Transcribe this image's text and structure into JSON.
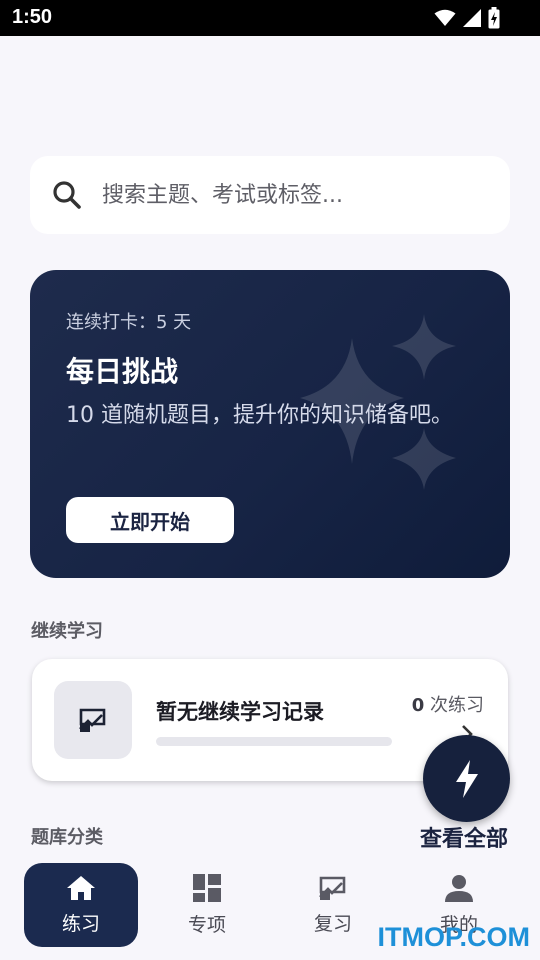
{
  "status_bar": {
    "time": "1:50"
  },
  "search": {
    "placeholder": "搜索主题、考试或标签..."
  },
  "daily_challenge": {
    "streak_text": "连续打卡：5 天",
    "title": "每日挑战",
    "description": "10 道随机题目，提升你的知识储备吧。",
    "button_label": "立即开始"
  },
  "continue_learning": {
    "section_label": "继续学习",
    "title": "暂无继续学习记录",
    "count_number": "0",
    "count_unit": "次练习",
    "progress": 0
  },
  "question_bank": {
    "section_label": "题库分类",
    "view_all": "查看全部"
  },
  "bottom_nav": {
    "items": [
      {
        "label": "练习",
        "icon": "home-icon",
        "active": true
      },
      {
        "label": "专项",
        "icon": "grid-icon",
        "active": false
      },
      {
        "label": "复习",
        "icon": "review-icon",
        "active": false
      },
      {
        "label": "我的",
        "icon": "person-icon",
        "active": false
      }
    ]
  },
  "watermark": "ITMOP.COM",
  "colors": {
    "accent": "#1b2a4f",
    "hero_bg": "#172445",
    "fab": "#16213d",
    "watermark": "#1e90d8"
  }
}
